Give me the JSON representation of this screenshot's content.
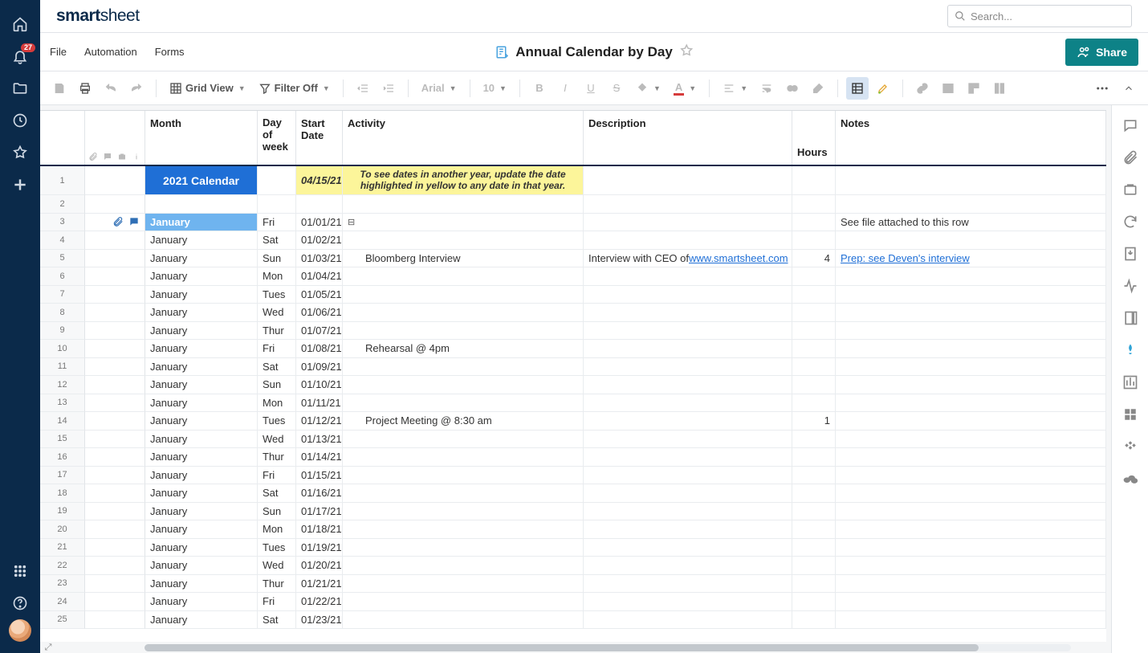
{
  "brand": "smartsheet",
  "notifications_count": "27",
  "search": {
    "placeholder": "Search..."
  },
  "menus": [
    "File",
    "Automation",
    "Forms"
  ],
  "sheet": {
    "title": "Annual Calendar by Day"
  },
  "share_label": "Share",
  "toolbar": {
    "grid_view": "Grid View",
    "filter_off": "Filter Off",
    "font_family": "Arial",
    "font_size": "10"
  },
  "columns": {
    "month": "Month",
    "dow1": "Day",
    "dow2": "of",
    "dow3": "week",
    "start_date": "Start Date",
    "activity": "Activity",
    "description": "Description",
    "hours": "Hours",
    "notes": "Notes"
  },
  "banner": {
    "month": "2021 Calendar",
    "date": "04/15/21",
    "activity": "To see dates in another year, update the date highlighted in yellow to any date in that year."
  },
  "rows": [
    {
      "num": "1",
      "type": "banner"
    },
    {
      "num": "2",
      "type": "empty"
    },
    {
      "num": "3",
      "type": "parent",
      "month": "January",
      "dow": "Fri",
      "date": "01/01/21",
      "collapse": "⊟",
      "attach": true,
      "comment": true,
      "notes": "See file attached to this row"
    },
    {
      "num": "4",
      "month": "January",
      "dow": "Sat",
      "date": "01/02/21"
    },
    {
      "num": "5",
      "month": "January",
      "dow": "Sun",
      "date": "01/03/21",
      "activity": "Bloomberg Interview",
      "desc_pre": "Interview with CEO of ",
      "desc_link": "www.smartsheet.com",
      "hours": "4",
      "notes_link": "Prep: see Deven's interview"
    },
    {
      "num": "6",
      "month": "January",
      "dow": "Mon",
      "date": "01/04/21"
    },
    {
      "num": "7",
      "month": "January",
      "dow": "Tues",
      "date": "01/05/21"
    },
    {
      "num": "8",
      "month": "January",
      "dow": "Wed",
      "date": "01/06/21"
    },
    {
      "num": "9",
      "month": "January",
      "dow": "Thur",
      "date": "01/07/21"
    },
    {
      "num": "10",
      "month": "January",
      "dow": "Fri",
      "date": "01/08/21",
      "activity": "Rehearsal @ 4pm"
    },
    {
      "num": "11",
      "month": "January",
      "dow": "Sat",
      "date": "01/09/21"
    },
    {
      "num": "12",
      "month": "January",
      "dow": "Sun",
      "date": "01/10/21"
    },
    {
      "num": "13",
      "month": "January",
      "dow": "Mon",
      "date": "01/11/21"
    },
    {
      "num": "14",
      "month": "January",
      "dow": "Tues",
      "date": "01/12/21",
      "activity": "Project Meeting @ 8:30 am",
      "hours": "1"
    },
    {
      "num": "15",
      "month": "January",
      "dow": "Wed",
      "date": "01/13/21"
    },
    {
      "num": "16",
      "month": "January",
      "dow": "Thur",
      "date": "01/14/21"
    },
    {
      "num": "17",
      "month": "January",
      "dow": "Fri",
      "date": "01/15/21"
    },
    {
      "num": "18",
      "month": "January",
      "dow": "Sat",
      "date": "01/16/21"
    },
    {
      "num": "19",
      "month": "January",
      "dow": "Sun",
      "date": "01/17/21"
    },
    {
      "num": "20",
      "month": "January",
      "dow": "Mon",
      "date": "01/18/21"
    },
    {
      "num": "21",
      "month": "January",
      "dow": "Tues",
      "date": "01/19/21"
    },
    {
      "num": "22",
      "month": "January",
      "dow": "Wed",
      "date": "01/20/21"
    },
    {
      "num": "23",
      "month": "January",
      "dow": "Thur",
      "date": "01/21/21"
    },
    {
      "num": "24",
      "month": "January",
      "dow": "Fri",
      "date": "01/22/21"
    },
    {
      "num": "25",
      "month": "January",
      "dow": "Sat",
      "date": "01/23/21"
    }
  ]
}
